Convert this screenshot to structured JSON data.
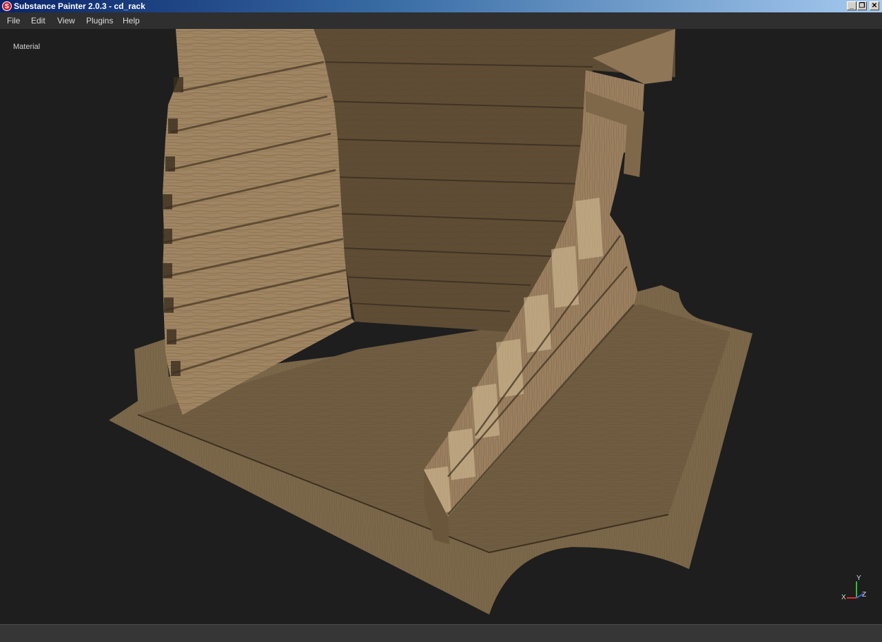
{
  "window": {
    "title": "Substance Painter 2.0.3 - cd_rack",
    "minimize": "_",
    "restore": "❐",
    "close": "✕"
  },
  "menu": [
    "File",
    "Edit",
    "View",
    "Plugins",
    "Help"
  ],
  "viewport": {
    "mode_label": "Material",
    "gizmo": {
      "y": "Y",
      "x": "X",
      "z": "Z"
    }
  },
  "colors": {
    "axis_x": "#e03030",
    "axis_y": "#30c030",
    "axis_z": "#3060e0"
  }
}
